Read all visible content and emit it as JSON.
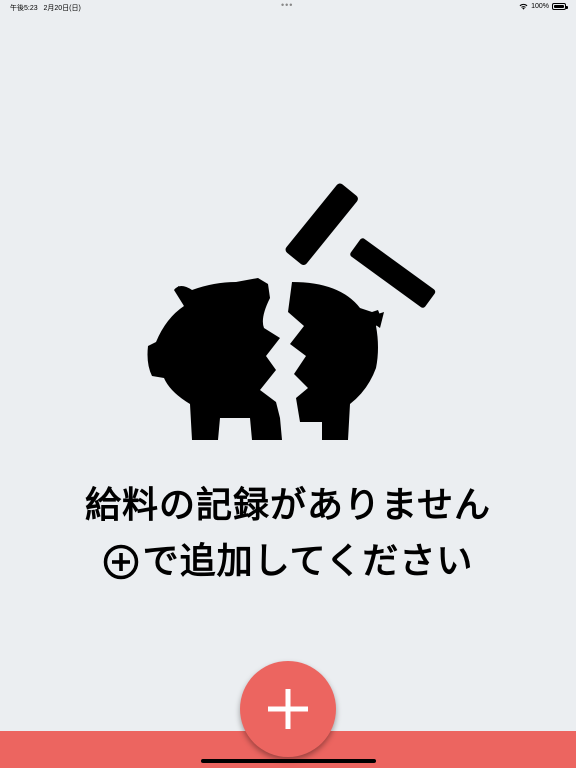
{
  "status_bar": {
    "time": "午後5:23",
    "date": "2月20日(日)",
    "battery": "100%",
    "icons": [
      "wifi-icon",
      "battery-icon"
    ]
  },
  "empty_state": {
    "icon": "broken-piggy-bank-icon",
    "line1": "給料の記録がありません",
    "line2": "で追加してください"
  },
  "fab": {
    "icon": "plus-icon"
  },
  "colors": {
    "background": "#ebeef1",
    "accent": "#ec6560",
    "text": "#000000"
  }
}
